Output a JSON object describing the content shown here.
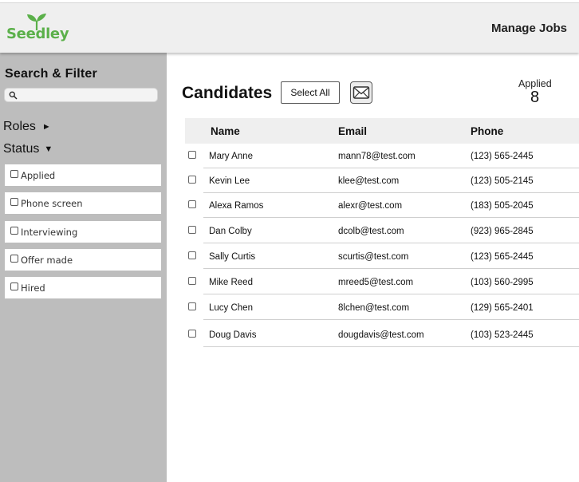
{
  "header": {
    "logo_text": "Seedley",
    "manage_jobs_label": "Manage Jobs"
  },
  "colors": {
    "brand_green": "#5bb04a",
    "sidebar_bg": "#bdbdbd",
    "header_bg": "#efefef"
  },
  "sidebar": {
    "title": "Search & Filter",
    "search": {
      "placeholder": "",
      "value": "",
      "icon": "search-icon"
    },
    "roles": {
      "label": "Roles",
      "arrow": "►",
      "expanded": false
    },
    "status": {
      "label": "Status",
      "arrow": "▼",
      "expanded": true,
      "options": [
        {
          "label": "Applied",
          "checked": false
        },
        {
          "label": "Phone screen",
          "checked": false
        },
        {
          "label": "Interviewing",
          "checked": false
        },
        {
          "label": "Offer made",
          "checked": false
        },
        {
          "label": "Hired",
          "checked": false
        }
      ]
    }
  },
  "main": {
    "title": "Candidates",
    "select_all_label": "Select All",
    "mail_icon": "mail-icon",
    "applied": {
      "label": "Applied",
      "count": "8"
    },
    "table": {
      "columns": [
        "Name",
        "Email",
        "Phone"
      ],
      "rows": [
        {
          "name": "Mary Anne",
          "email": "mann78@test.com",
          "phone": "(123) 565-2445"
        },
        {
          "name": "Kevin Lee",
          "email": "klee@test.com",
          "phone": "(123) 505-2145"
        },
        {
          "name": "Alexa Ramos",
          "email": "alexr@test.com",
          "phone": "(183) 505-2045"
        },
        {
          "name": "Dan Colby",
          "email": "dcolb@test.com",
          "phone": "(923) 965-2845"
        },
        {
          "name": "Sally Curtis",
          "email": "scurtis@test.com",
          "phone": "(123) 565-2445"
        },
        {
          "name": "Mike Reed",
          "email": "mreed5@test.com",
          "phone": "(103) 560-2995"
        },
        {
          "name": "Lucy Chen",
          "email": "8lchen@test.com",
          "phone": "(129) 565-2401"
        },
        {
          "name": "Doug Davis",
          "email": "dougdavis@test.com",
          "phone": "(103) 523-2445"
        }
      ]
    }
  }
}
